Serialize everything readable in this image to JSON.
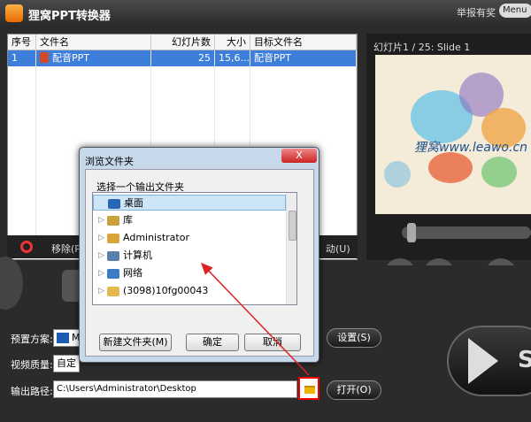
{
  "titlebar": {
    "title": "狸窝PPT转换器",
    "report": "举报有奖",
    "menu": "Menu"
  },
  "list": {
    "headers": [
      "序号",
      "文件名",
      "幻灯片数",
      "大小",
      "目标文件名"
    ],
    "rows": [
      {
        "index": "1",
        "name": "配音PPT",
        "slides": "25",
        "size": "15,6...",
        "target": "配音PPT"
      }
    ]
  },
  "toolbar": {
    "remove": "移除(R)",
    "auto": "动(U)"
  },
  "preview": {
    "title": "幻灯片1 / 25: Slide 1",
    "slide_text": "狸窝www.leawo.cn"
  },
  "settings": {
    "preset_label": "预置方案:",
    "preset_value": "M",
    "quality_label": "视频质量:",
    "quality_value": "自定",
    "path_label": "输出路径:",
    "path_value": "C:\\Users\\Administrator\\Desktop",
    "settings_button": "设置(S)",
    "open_button": "打开(O)",
    "start_label": "S"
  },
  "dialog": {
    "title": "浏览文件夹",
    "close": "X",
    "prompt": "选择一个输出文件夹",
    "tree": [
      {
        "label": "桌面",
        "icon": "desktop-icon",
        "color": "#2a66b8"
      },
      {
        "label": "库",
        "icon": "library-icon",
        "color": "#c9a23a"
      },
      {
        "label": "Administrator",
        "icon": "user-folder-icon",
        "color": "#d8a53a"
      },
      {
        "label": "计算机",
        "icon": "computer-icon",
        "color": "#5a7ea8"
      },
      {
        "label": "网络",
        "icon": "network-icon",
        "color": "#3b7ac4"
      },
      {
        "label": "(3098)10fg00043",
        "icon": "folder-icon",
        "color": "#e5b84b"
      }
    ],
    "new_folder": "新建文件夹(M)",
    "ok": "确定",
    "cancel": "取消"
  },
  "colors": {
    "selection": "#3d7edb",
    "highlight_box": "#ee0000",
    "arrow": "#dd2222"
  }
}
